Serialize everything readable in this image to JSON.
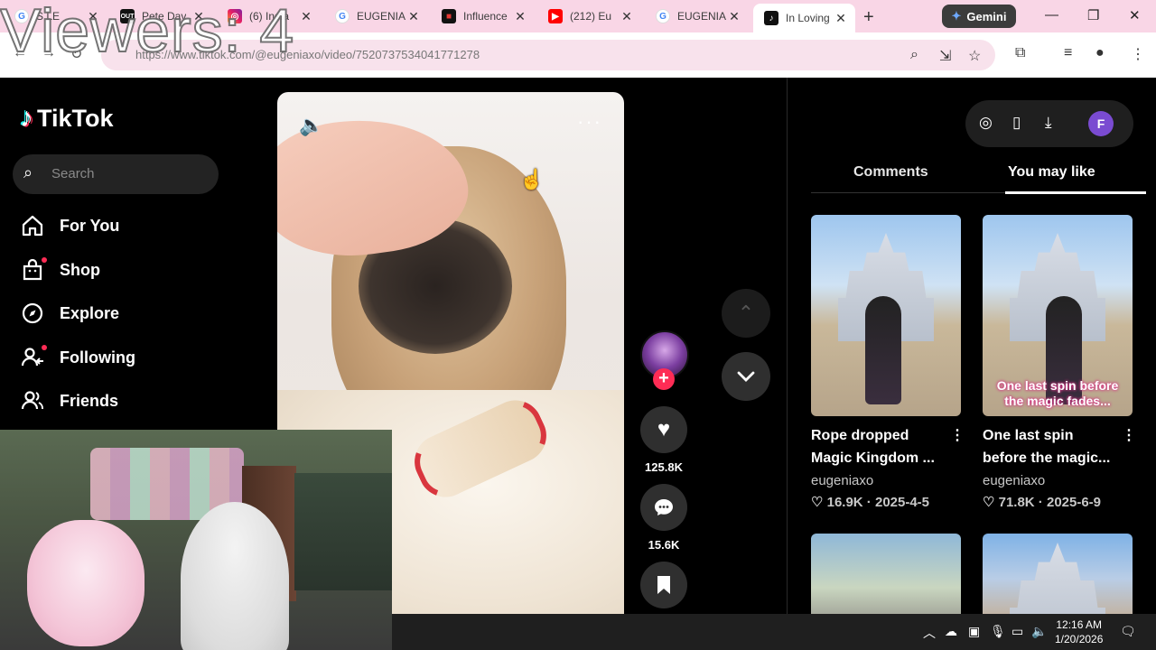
{
  "overlay": {
    "viewers": "Viewers: 4"
  },
  "browser": {
    "tabs": [
      {
        "label": "S LE",
        "icon": "google-icon"
      },
      {
        "label": "Pete Dav",
        "icon": "out-icon"
      },
      {
        "label": "(6) Insta",
        "icon": "instagram-icon"
      },
      {
        "label": "EUGENIA",
        "icon": "google-icon"
      },
      {
        "label": "Influence",
        "icon": "influence-icon"
      },
      {
        "label": "(212) Eu",
        "icon": "youtube-icon"
      },
      {
        "label": "EUGENIA",
        "icon": "google-icon"
      },
      {
        "label": "In Loving",
        "icon": "tiktok-icon"
      }
    ],
    "gemini_label": "Gemini",
    "url": "https://www.tiktok.com/@eugeniaxo/video/7520737534041771278"
  },
  "tiktok": {
    "logo_text": "TikTok",
    "search_placeholder": "Search",
    "nav": [
      {
        "label": "For You",
        "icon": "home-icon"
      },
      {
        "label": "Shop",
        "icon": "shop-icon"
      },
      {
        "label": "Explore",
        "icon": "compass-icon"
      },
      {
        "label": "Following",
        "icon": "following-icon"
      },
      {
        "label": "Friends",
        "icon": "friends-icon"
      }
    ],
    "actions": {
      "likes": "125.8K",
      "comments": "15.6K"
    },
    "profile_initial": "F",
    "panel_tabs": {
      "comments": "Comments",
      "you_may_like": "You may like"
    },
    "cards": [
      {
        "title": "Rope dropped Magic Kingdom ...",
        "user": "eugeniaxo",
        "meta": "♡ 16.9K · 2025-4-5",
        "caption": ""
      },
      {
        "title": "One last spin before the magic...",
        "user": "eugeniaxo",
        "meta": "♡ 71.8K · 2025-6-9",
        "caption": "One last spin before the magic fades..."
      }
    ]
  },
  "taskbar": {
    "time": "12:16 AM",
    "date": "1/20/2026"
  }
}
